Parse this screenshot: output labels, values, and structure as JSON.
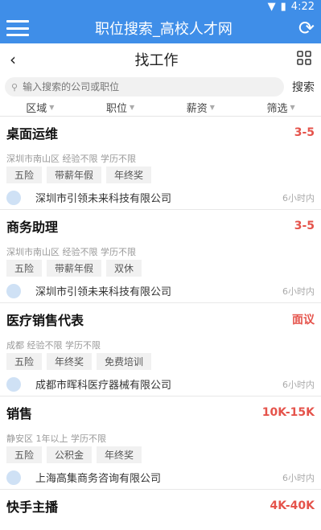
{
  "status": {
    "time": "4:22"
  },
  "appbar": {
    "title": "职位搜索_高校人才网"
  },
  "page": {
    "title": "找工作"
  },
  "search": {
    "placeholder": "输入搜索的公司或职位",
    "button": "搜索"
  },
  "filters": [
    "区域",
    "职位",
    "薪资",
    "筛选"
  ],
  "jobs": [
    {
      "title": "桌面运维",
      "salary": "3-5",
      "meta": "深圳市南山区 经验不限 学历不限",
      "tags": [
        "五险",
        "带薪年假",
        "年终奖"
      ],
      "company": "深圳市引领未来科技有限公司",
      "time": "6小时内"
    },
    {
      "title": "商务助理",
      "salary": "3-5",
      "meta": "深圳市南山区 经验不限 学历不限",
      "tags": [
        "五险",
        "带薪年假",
        "双休"
      ],
      "company": "深圳市引领未来科技有限公司",
      "time": "6小时内"
    },
    {
      "title": "医疗销售代表",
      "salary": "面议",
      "meta": "成都 经验不限 学历不限",
      "tags": [
        "五险",
        "年终奖",
        "免费培训"
      ],
      "company": "成都市晖科医疗器械有限公司",
      "time": "6小时内"
    },
    {
      "title": "销售",
      "salary": "10K-15K",
      "meta": "静安区 1年以上 学历不限",
      "tags": [
        "五险",
        "公积金",
        "年终奖"
      ],
      "company": "上海高集商务咨询有限公司",
      "time": "6小时内"
    },
    {
      "title": "快手主播",
      "salary": "4K-40K",
      "meta": "",
      "tags": [],
      "company": "",
      "time": ""
    }
  ]
}
